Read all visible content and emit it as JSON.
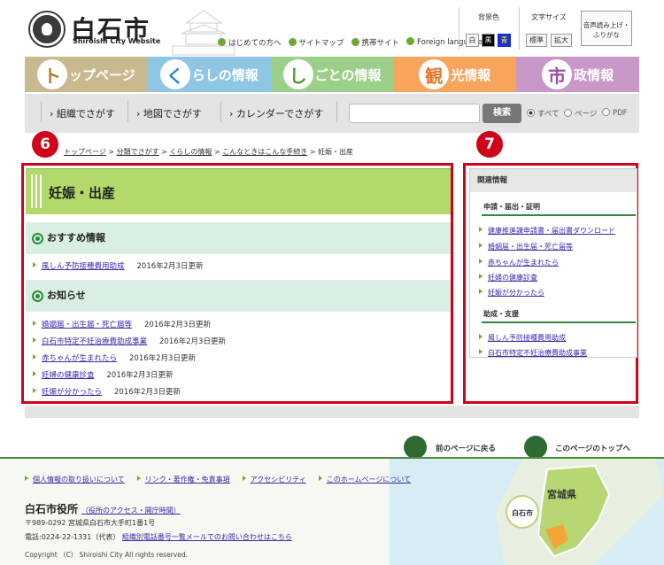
{
  "header": {
    "logo_text": "白石市",
    "logo_sub": "Shiroishi City Website",
    "top_links": [
      "はじめての方へ",
      "サイトマップ",
      "携帯サイト",
      "Foreign language"
    ],
    "bg_color_label": "背景色",
    "bg_options": [
      "白",
      "黒",
      "青"
    ],
    "font_size_label": "文字サイズ",
    "font_options": [
      "標準",
      "拡大"
    ],
    "read_aloud": "音声読み上げ・ふりがな"
  },
  "nav": [
    {
      "initial": "ト",
      "rest": "ップページ",
      "color": "#c9b98f",
      "initial_color": "#b07a2a"
    },
    {
      "initial": "く",
      "rest": "らしの情報",
      "color": "#8ec6e4",
      "initial_color": "#2c88c0"
    },
    {
      "initial": "し",
      "rest": "ごとの情報",
      "color": "#9cd08a",
      "initial_color": "#4f9e3a"
    },
    {
      "initial": "観",
      "rest": "光情報",
      "color": "#f7a55c",
      "initial_color": "#e5792a"
    },
    {
      "initial": "市",
      "rest": "政情報",
      "color": "#c898c9",
      "initial_color": "#9a4f9e"
    }
  ],
  "subnav": {
    "links": [
      "組織でさがす",
      "地図でさがす",
      "カレンダーでさがす"
    ],
    "search_button": "検索",
    "radio": [
      "すべて",
      "ページ",
      "PDF"
    ]
  },
  "badges": [
    "6",
    "7"
  ],
  "breadcrumb": [
    "トップページ",
    "分類でさがす",
    "くらしの情報",
    "こんなときはこんな手続き",
    "妊娠・出産"
  ],
  "main": {
    "title": "妊娠・出産",
    "recommended": {
      "heading": "おすすめ情報",
      "items": [
        {
          "link": "風しん予防接種費用助成",
          "date": "2016年2月3日更新"
        }
      ]
    },
    "news": {
      "heading": "お知らせ",
      "items": [
        {
          "link": "婚姻届・出生届・死亡届等",
          "date": "2016年2月3日更新"
        },
        {
          "link": "白石市特定不妊治療費助成事業",
          "date": "2016年2月3日更新"
        },
        {
          "link": "赤ちゃんが生まれたら",
          "date": "2016年2月3日更新"
        },
        {
          "link": "妊婦の健康診査",
          "date": "2016年2月3日更新"
        },
        {
          "link": "妊娠が分かったら",
          "date": "2016年2月3日更新"
        }
      ]
    }
  },
  "side": {
    "heading": "関連情報",
    "groups": [
      {
        "title": "申請・届出・証明",
        "links": [
          "健康推進課申請書・届出書ダウンロード",
          "婚姻届・出生届・死亡届等",
          "赤ちゃんが生まれたら",
          "妊婦の健康診査",
          "妊娠が分かったら"
        ]
      },
      {
        "title": "助成・支援",
        "links": [
          "風しん予防接種費用助成",
          "白石市特定不妊治療費助成事業"
        ]
      }
    ]
  },
  "pager": {
    "back": "前のページに戻る",
    "top": "このページのトップへ"
  },
  "footer": {
    "links": [
      "個人情報の取り扱いについて",
      "リンク・著作権・免責事項",
      "アクセシビリティ",
      "このホームページについて"
    ],
    "office": "白石市役所",
    "office_access": "（役所のアクセス・開庁時間）",
    "address": "〒989-0292 宮城県白石市大手町1番1号",
    "phone": "電話:0224-22-1331（代表）",
    "phone_link": "組織別電話番号一覧メールでのお問い合わせはこちら",
    "copyright": "Copyright （C） Shiroishi City All rights reserved.",
    "map_pref": "宮城県",
    "map_city": "白石市"
  }
}
